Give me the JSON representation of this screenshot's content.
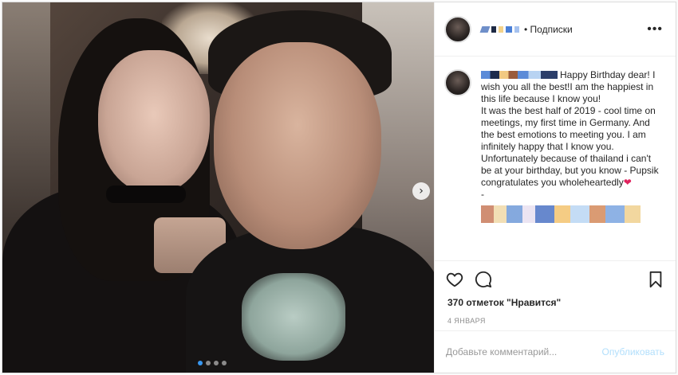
{
  "header": {
    "subscribe_label": "• Подписки",
    "more_icon": "ellipsis-icon"
  },
  "caption": {
    "text": "Happy Birthday dear! I wish you all the best!I am the happiest in this life because I know you!\nIt was the best half of 2019 - cool time on meetings, my first time in Germany. And the best emotions to meeting you. I am infinitely happy that I know you. Unfortunately because of thailand i can't be at your birthday, but you know - Pupsik congratulates you wholeheartedly",
    "heart": "❤",
    "dash": "-"
  },
  "likes": "370 отметок \"Нравится\"",
  "date": "4 января",
  "comment": {
    "placeholder": "Добавьте комментарий...",
    "publish_label": "Опубликовать"
  },
  "colors": {
    "accent": "#3897f0",
    "publish_disabled": "#b2dffc",
    "heart": "#e0245e"
  }
}
